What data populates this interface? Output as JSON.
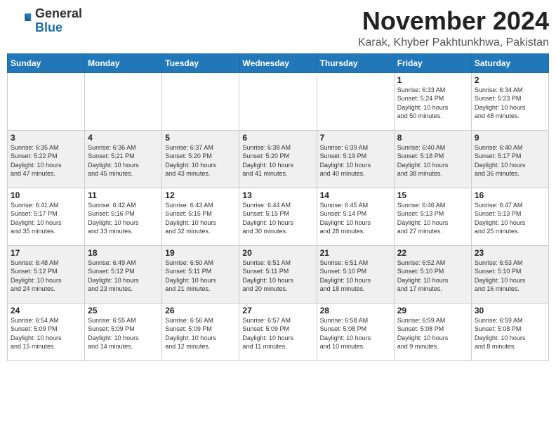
{
  "logo": {
    "general": "General",
    "blue": "Blue"
  },
  "header": {
    "month_year": "November 2024",
    "location": "Karak, Khyber Pakhtunkhwa, Pakistan"
  },
  "weekdays": [
    "Sunday",
    "Monday",
    "Tuesday",
    "Wednesday",
    "Thursday",
    "Friday",
    "Saturday"
  ],
  "weeks": [
    [
      {
        "day": "",
        "info": ""
      },
      {
        "day": "",
        "info": ""
      },
      {
        "day": "",
        "info": ""
      },
      {
        "day": "",
        "info": ""
      },
      {
        "day": "",
        "info": ""
      },
      {
        "day": "1",
        "info": "Sunrise: 6:33 AM\nSunset: 5:24 PM\nDaylight: 10 hours\nand 50 minutes."
      },
      {
        "day": "2",
        "info": "Sunrise: 6:34 AM\nSunset: 5:23 PM\nDaylight: 10 hours\nand 48 minutes."
      }
    ],
    [
      {
        "day": "3",
        "info": "Sunrise: 6:35 AM\nSunset: 5:22 PM\nDaylight: 10 hours\nand 47 minutes."
      },
      {
        "day": "4",
        "info": "Sunrise: 6:36 AM\nSunset: 5:21 PM\nDaylight: 10 hours\nand 45 minutes."
      },
      {
        "day": "5",
        "info": "Sunrise: 6:37 AM\nSunset: 5:20 PM\nDaylight: 10 hours\nand 43 minutes."
      },
      {
        "day": "6",
        "info": "Sunrise: 6:38 AM\nSunset: 5:20 PM\nDaylight: 10 hours\nand 41 minutes."
      },
      {
        "day": "7",
        "info": "Sunrise: 6:39 AM\nSunset: 5:19 PM\nDaylight: 10 hours\nand 40 minutes."
      },
      {
        "day": "8",
        "info": "Sunrise: 6:40 AM\nSunset: 5:18 PM\nDaylight: 10 hours\nand 38 minutes."
      },
      {
        "day": "9",
        "info": "Sunrise: 6:40 AM\nSunset: 5:17 PM\nDaylight: 10 hours\nand 36 minutes."
      }
    ],
    [
      {
        "day": "10",
        "info": "Sunrise: 6:41 AM\nSunset: 5:17 PM\nDaylight: 10 hours\nand 35 minutes."
      },
      {
        "day": "11",
        "info": "Sunrise: 6:42 AM\nSunset: 5:16 PM\nDaylight: 10 hours\nand 33 minutes."
      },
      {
        "day": "12",
        "info": "Sunrise: 6:43 AM\nSunset: 5:15 PM\nDaylight: 10 hours\nand 32 minutes."
      },
      {
        "day": "13",
        "info": "Sunrise: 6:44 AM\nSunset: 5:15 PM\nDaylight: 10 hours\nand 30 minutes."
      },
      {
        "day": "14",
        "info": "Sunrise: 6:45 AM\nSunset: 5:14 PM\nDaylight: 10 hours\nand 28 minutes."
      },
      {
        "day": "15",
        "info": "Sunrise: 6:46 AM\nSunset: 5:13 PM\nDaylight: 10 hours\nand 27 minutes."
      },
      {
        "day": "16",
        "info": "Sunrise: 6:47 AM\nSunset: 5:13 PM\nDaylight: 10 hours\nand 25 minutes."
      }
    ],
    [
      {
        "day": "17",
        "info": "Sunrise: 6:48 AM\nSunset: 5:12 PM\nDaylight: 10 hours\nand 24 minutes."
      },
      {
        "day": "18",
        "info": "Sunrise: 6:49 AM\nSunset: 5:12 PM\nDaylight: 10 hours\nand 23 minutes."
      },
      {
        "day": "19",
        "info": "Sunrise: 6:50 AM\nSunset: 5:11 PM\nDaylight: 10 hours\nand 21 minutes."
      },
      {
        "day": "20",
        "info": "Sunrise: 6:51 AM\nSunset: 5:11 PM\nDaylight: 10 hours\nand 20 minutes."
      },
      {
        "day": "21",
        "info": "Sunrise: 6:51 AM\nSunset: 5:10 PM\nDaylight: 10 hours\nand 18 minutes."
      },
      {
        "day": "22",
        "info": "Sunrise: 6:52 AM\nSunset: 5:10 PM\nDaylight: 10 hours\nand 17 minutes."
      },
      {
        "day": "23",
        "info": "Sunrise: 6:53 AM\nSunset: 5:10 PM\nDaylight: 10 hours\nand 16 minutes."
      }
    ],
    [
      {
        "day": "24",
        "info": "Sunrise: 6:54 AM\nSunset: 5:09 PM\nDaylight: 10 hours\nand 15 minutes."
      },
      {
        "day": "25",
        "info": "Sunrise: 6:55 AM\nSunset: 5:09 PM\nDaylight: 10 hours\nand 14 minutes."
      },
      {
        "day": "26",
        "info": "Sunrise: 6:56 AM\nSunset: 5:09 PM\nDaylight: 10 hours\nand 12 minutes."
      },
      {
        "day": "27",
        "info": "Sunrise: 6:57 AM\nSunset: 5:09 PM\nDaylight: 10 hours\nand 11 minutes."
      },
      {
        "day": "28",
        "info": "Sunrise: 6:58 AM\nSunset: 5:08 PM\nDaylight: 10 hours\nand 10 minutes."
      },
      {
        "day": "29",
        "info": "Sunrise: 6:59 AM\nSunset: 5:08 PM\nDaylight: 10 hours\nand 9 minutes."
      },
      {
        "day": "30",
        "info": "Sunrise: 6:59 AM\nSunset: 5:08 PM\nDaylight: 10 hours\nand 8 minutes."
      }
    ]
  ]
}
